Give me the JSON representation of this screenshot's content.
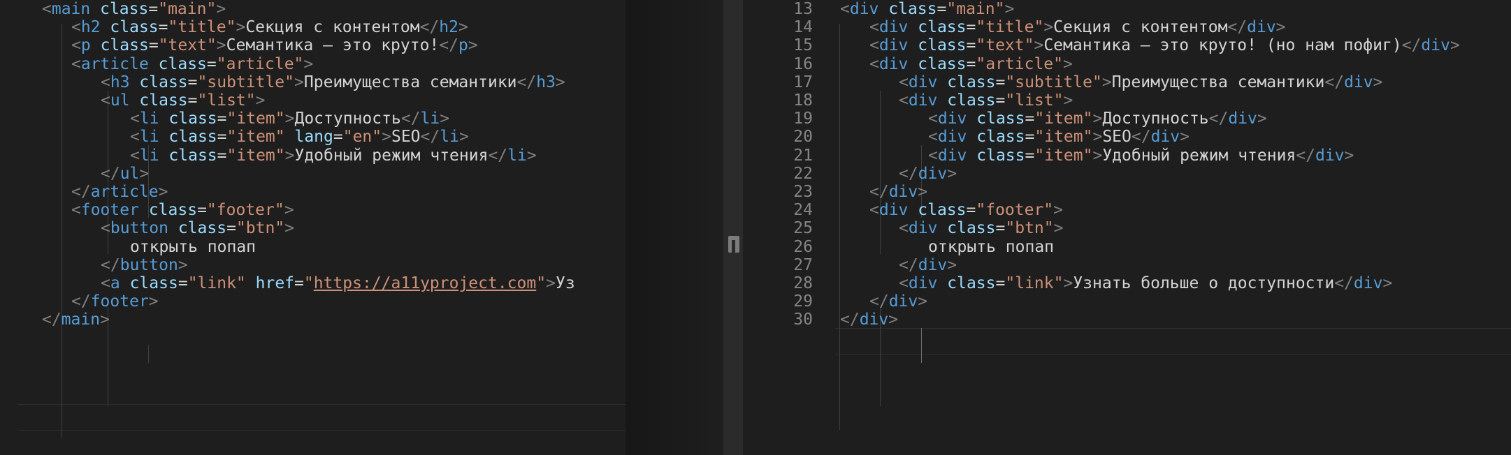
{
  "left_editor": {
    "lines": [
      [
        [
          "punc",
          "<"
        ],
        [
          "tag",
          "main"
        ],
        [
          "txt",
          " "
        ],
        [
          "attr",
          "class"
        ],
        [
          "txt",
          "="
        ],
        [
          "str",
          "\"main\""
        ],
        [
          "punc",
          ">"
        ]
      ],
      [
        [
          "punc",
          "<"
        ],
        [
          "tag",
          "h2"
        ],
        [
          "txt",
          " "
        ],
        [
          "attr",
          "class"
        ],
        [
          "txt",
          "="
        ],
        [
          "str",
          "\"title\""
        ],
        [
          "punc",
          ">"
        ],
        [
          "txt",
          "Секция с контентом"
        ],
        [
          "punc",
          "</"
        ],
        [
          "tag",
          "h2"
        ],
        [
          "punc",
          ">"
        ]
      ],
      [
        [
          "punc",
          "<"
        ],
        [
          "tag",
          "p"
        ],
        [
          "txt",
          " "
        ],
        [
          "attr",
          "class"
        ],
        [
          "txt",
          "="
        ],
        [
          "str",
          "\"text\""
        ],
        [
          "punc",
          ">"
        ],
        [
          "txt",
          "Семантика – это круто!"
        ],
        [
          "punc",
          "</"
        ],
        [
          "tag",
          "p"
        ],
        [
          "punc",
          ">"
        ]
      ],
      [
        [
          "punc",
          "<"
        ],
        [
          "tag",
          "article"
        ],
        [
          "txt",
          " "
        ],
        [
          "attr",
          "class"
        ],
        [
          "txt",
          "="
        ],
        [
          "str",
          "\"article\""
        ],
        [
          "punc",
          ">"
        ]
      ],
      [
        [
          "punc",
          "<"
        ],
        [
          "tag",
          "h3"
        ],
        [
          "txt",
          " "
        ],
        [
          "attr",
          "class"
        ],
        [
          "txt",
          "="
        ],
        [
          "str",
          "\"subtitle\""
        ],
        [
          "punc",
          ">"
        ],
        [
          "txt",
          "Преимущества семантики"
        ],
        [
          "punc",
          "</"
        ],
        [
          "tag",
          "h3"
        ],
        [
          "punc",
          ">"
        ]
      ],
      [
        [
          "punc",
          "<"
        ],
        [
          "tag",
          "ul"
        ],
        [
          "txt",
          " "
        ],
        [
          "attr",
          "class"
        ],
        [
          "txt",
          "="
        ],
        [
          "str",
          "\"list\""
        ],
        [
          "punc",
          ">"
        ]
      ],
      [
        [
          "punc",
          "<"
        ],
        [
          "tag",
          "li"
        ],
        [
          "txt",
          " "
        ],
        [
          "attr",
          "class"
        ],
        [
          "txt",
          "="
        ],
        [
          "str",
          "\"item\""
        ],
        [
          "punc",
          ">"
        ],
        [
          "txt",
          "Доступность"
        ],
        [
          "punc",
          "</"
        ],
        [
          "tag",
          "li"
        ],
        [
          "punc",
          ">"
        ]
      ],
      [
        [
          "punc",
          "<"
        ],
        [
          "tag",
          "li"
        ],
        [
          "txt",
          " "
        ],
        [
          "attr",
          "class"
        ],
        [
          "txt",
          "="
        ],
        [
          "str",
          "\"item\""
        ],
        [
          "txt",
          " "
        ],
        [
          "attr",
          "lang"
        ],
        [
          "txt",
          "="
        ],
        [
          "str",
          "\"en\""
        ],
        [
          "punc",
          ">"
        ],
        [
          "txt",
          "SEO"
        ],
        [
          "punc",
          "</"
        ],
        [
          "tag",
          "li"
        ],
        [
          "punc",
          ">"
        ]
      ],
      [
        [
          "punc",
          "<"
        ],
        [
          "tag",
          "li"
        ],
        [
          "txt",
          " "
        ],
        [
          "attr",
          "class"
        ],
        [
          "txt",
          "="
        ],
        [
          "str",
          "\"item\""
        ],
        [
          "punc",
          ">"
        ],
        [
          "txt",
          "Удобный режим чтения"
        ],
        [
          "punc",
          "</"
        ],
        [
          "tag",
          "li"
        ],
        [
          "punc",
          ">"
        ]
      ],
      [
        [
          "punc",
          "</"
        ],
        [
          "tag",
          "ul"
        ],
        [
          "punc",
          ">"
        ]
      ],
      [
        [
          "punc",
          "</"
        ],
        [
          "tag",
          "article"
        ],
        [
          "punc",
          ">"
        ]
      ],
      [
        [
          "punc",
          "<"
        ],
        [
          "tag",
          "footer"
        ],
        [
          "txt",
          " "
        ],
        [
          "attr",
          "class"
        ],
        [
          "txt",
          "="
        ],
        [
          "str",
          "\"footer\""
        ],
        [
          "punc",
          ">"
        ]
      ],
      [
        [
          "punc",
          "<"
        ],
        [
          "tag",
          "button"
        ],
        [
          "txt",
          " "
        ],
        [
          "attr",
          "class"
        ],
        [
          "txt",
          "="
        ],
        [
          "str",
          "\"btn\""
        ],
        [
          "punc",
          ">"
        ]
      ],
      [
        [
          "txt",
          "открыть попап"
        ]
      ],
      [
        [
          "punc",
          "</"
        ],
        [
          "tag",
          "button"
        ],
        [
          "punc",
          ">"
        ]
      ],
      [
        [
          "punc",
          "<"
        ],
        [
          "tag",
          "a"
        ],
        [
          "txt",
          " "
        ],
        [
          "attr",
          "class"
        ],
        [
          "txt",
          "="
        ],
        [
          "str",
          "\"link\""
        ],
        [
          "txt",
          " "
        ],
        [
          "attr",
          "href"
        ],
        [
          "txt",
          "="
        ],
        [
          "str",
          "\""
        ],
        [
          "url",
          "https://a11yproject.com"
        ],
        [
          "str",
          "\""
        ],
        [
          "punc",
          ">"
        ],
        [
          "txt",
          "Уз"
        ]
      ],
      [
        [
          "punc",
          "</"
        ],
        [
          "tag",
          "footer"
        ],
        [
          "punc",
          ">"
        ]
      ],
      [
        [
          "punc",
          "</"
        ],
        [
          "tag",
          "main"
        ],
        [
          "punc",
          ">"
        ]
      ]
    ]
  },
  "right_editor": {
    "line_numbers": [
      "13",
      "14",
      "15",
      "16",
      "17",
      "18",
      "19",
      "20",
      "21",
      "22",
      "23",
      "24",
      "25",
      "26",
      "27",
      "28",
      "29",
      "30"
    ],
    "lines": [
      [
        [
          "punc",
          "<"
        ],
        [
          "tag",
          "div"
        ],
        [
          "txt",
          " "
        ],
        [
          "attr",
          "class"
        ],
        [
          "txt",
          "="
        ],
        [
          "str",
          "\"main\""
        ],
        [
          "punc",
          ">"
        ]
      ],
      [
        [
          "punc",
          "<"
        ],
        [
          "tag",
          "div"
        ],
        [
          "txt",
          " "
        ],
        [
          "attr",
          "class"
        ],
        [
          "txt",
          "="
        ],
        [
          "str",
          "\"title\""
        ],
        [
          "punc",
          ">"
        ],
        [
          "txt",
          "Секция с контентом"
        ],
        [
          "punc",
          "</"
        ],
        [
          "tag",
          "div"
        ],
        [
          "punc",
          ">"
        ]
      ],
      [
        [
          "punc",
          "<"
        ],
        [
          "tag",
          "div"
        ],
        [
          "txt",
          " "
        ],
        [
          "attr",
          "class"
        ],
        [
          "txt",
          "="
        ],
        [
          "str",
          "\"text\""
        ],
        [
          "punc",
          ">"
        ],
        [
          "txt",
          "Семантика – это круто! (но нам пофиг)"
        ],
        [
          "punc",
          "</"
        ],
        [
          "tag",
          "div"
        ],
        [
          "punc",
          ">"
        ]
      ],
      [
        [
          "punc",
          "<"
        ],
        [
          "tag",
          "div"
        ],
        [
          "txt",
          " "
        ],
        [
          "attr",
          "class"
        ],
        [
          "txt",
          "="
        ],
        [
          "str",
          "\"article\""
        ],
        [
          "punc",
          ">"
        ]
      ],
      [
        [
          "punc",
          "<"
        ],
        [
          "tag",
          "div"
        ],
        [
          "txt",
          " "
        ],
        [
          "attr",
          "class"
        ],
        [
          "txt",
          "="
        ],
        [
          "str",
          "\"subtitle\""
        ],
        [
          "punc",
          ">"
        ],
        [
          "txt",
          "Преимущества семантики"
        ],
        [
          "punc",
          "</"
        ],
        [
          "tag",
          "div"
        ],
        [
          "punc",
          ">"
        ]
      ],
      [
        [
          "punc",
          "<"
        ],
        [
          "tag",
          "div"
        ],
        [
          "txt",
          " "
        ],
        [
          "attr",
          "class"
        ],
        [
          "txt",
          "="
        ],
        [
          "str",
          "\"list\""
        ],
        [
          "punc",
          ">"
        ]
      ],
      [
        [
          "punc",
          "<"
        ],
        [
          "tag",
          "div"
        ],
        [
          "txt",
          " "
        ],
        [
          "attr",
          "class"
        ],
        [
          "txt",
          "="
        ],
        [
          "str",
          "\"item\""
        ],
        [
          "punc",
          ">"
        ],
        [
          "txt",
          "Доступность"
        ],
        [
          "punc",
          "</"
        ],
        [
          "tag",
          "div"
        ],
        [
          "punc",
          ">"
        ]
      ],
      [
        [
          "punc",
          "<"
        ],
        [
          "tag",
          "div"
        ],
        [
          "txt",
          " "
        ],
        [
          "attr",
          "class"
        ],
        [
          "txt",
          "="
        ],
        [
          "str",
          "\"item\""
        ],
        [
          "punc",
          ">"
        ],
        [
          "txt",
          "SEO"
        ],
        [
          "punc",
          "</"
        ],
        [
          "tag",
          "div"
        ],
        [
          "punc",
          ">"
        ]
      ],
      [
        [
          "punc",
          "<"
        ],
        [
          "tag",
          "div"
        ],
        [
          "txt",
          " "
        ],
        [
          "attr",
          "class"
        ],
        [
          "txt",
          "="
        ],
        [
          "str",
          "\"item\""
        ],
        [
          "punc",
          ">"
        ],
        [
          "txt",
          "Удобный режим чтения"
        ],
        [
          "punc",
          "</"
        ],
        [
          "tag",
          "div"
        ],
        [
          "punc",
          ">"
        ]
      ],
      [
        [
          "punc",
          "</"
        ],
        [
          "tag",
          "div"
        ],
        [
          "punc",
          ">"
        ]
      ],
      [
        [
          "punc",
          "</"
        ],
        [
          "tag",
          "div"
        ],
        [
          "punc",
          ">"
        ]
      ],
      [
        [
          "punc",
          "<"
        ],
        [
          "tag",
          "div"
        ],
        [
          "txt",
          " "
        ],
        [
          "attr",
          "class"
        ],
        [
          "txt",
          "="
        ],
        [
          "str",
          "\"footer\""
        ],
        [
          "punc",
          ">"
        ]
      ],
      [
        [
          "punc",
          "<"
        ],
        [
          "tag",
          "div"
        ],
        [
          "txt",
          " "
        ],
        [
          "attr",
          "class"
        ],
        [
          "txt",
          "="
        ],
        [
          "str",
          "\"btn\""
        ],
        [
          "punc",
          ">"
        ]
      ],
      [
        [
          "txt",
          "открыть попап"
        ]
      ],
      [
        [
          "punc",
          "</"
        ],
        [
          "tag",
          "div"
        ],
        [
          "punc",
          ">"
        ]
      ],
      [
        [
          "punc",
          "<"
        ],
        [
          "tag",
          "div"
        ],
        [
          "txt",
          " "
        ],
        [
          "attr",
          "class"
        ],
        [
          "txt",
          "="
        ],
        [
          "str",
          "\"link\""
        ],
        [
          "punc",
          ">"
        ],
        [
          "txt",
          "Узнать больше о доступности"
        ],
        [
          "punc",
          "</"
        ],
        [
          "tag",
          "div"
        ],
        [
          "punc",
          ">"
        ]
      ],
      [
        [
          "punc",
          "</"
        ],
        [
          "tag",
          "div"
        ],
        [
          "punc",
          ">"
        ]
      ],
      [
        [
          "punc",
          "</"
        ],
        [
          "tag",
          "div"
        ],
        [
          "punc",
          ">"
        ]
      ]
    ]
  },
  "colors": {
    "background": "#1e1e1e",
    "tag": "#569cd6",
    "attribute": "#9cdcfe",
    "string": "#ce9178",
    "punctuation": "#808080",
    "text": "#d4d4d4",
    "line_number": "#858585"
  }
}
